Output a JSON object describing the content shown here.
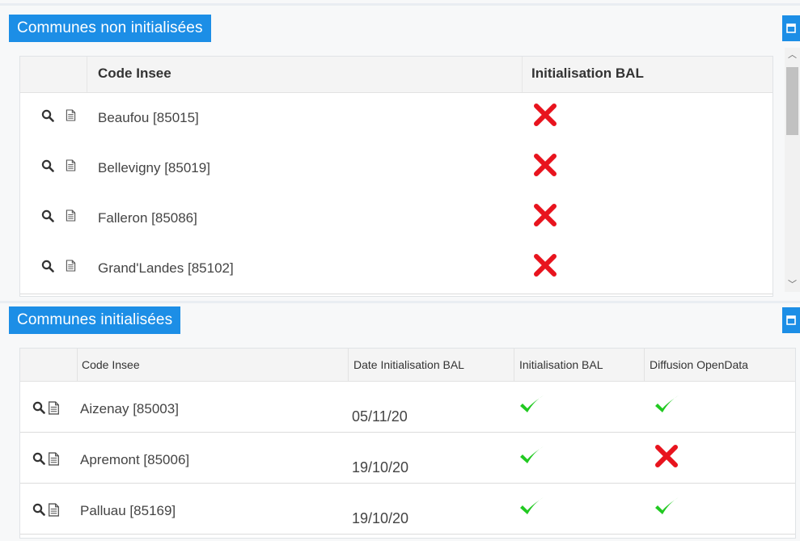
{
  "panels": {
    "top": {
      "title": "Communes non initialisées",
      "columns": {
        "code": "Code Insee",
        "init": "Initialisation BAL"
      },
      "rows": [
        {
          "name": "Beaufou [85015]",
          "init": "cross"
        },
        {
          "name": "Bellevigny [85019]",
          "init": "cross"
        },
        {
          "name": "Falleron [85086]",
          "init": "cross"
        },
        {
          "name": "Grand'Landes [85102]",
          "init": "cross"
        }
      ]
    },
    "bottom": {
      "title": "Communes initialisées",
      "columns": {
        "code": "Code Insee",
        "date": "Date Initialisation BAL",
        "init": "Initialisation BAL",
        "diffusion": "Diffusion OpenData"
      },
      "rows": [
        {
          "name": "Aizenay [85003]",
          "date": "05/11/20",
          "init": "check",
          "diffusion": "check"
        },
        {
          "name": "Apremont [85006]",
          "date": "19/10/20",
          "init": "check",
          "diffusion": "cross"
        },
        {
          "name": "Palluau [85169]",
          "date": "19/10/20",
          "init": "check",
          "diffusion": "check"
        }
      ]
    }
  },
  "icons": {
    "row_actions": [
      "search-icon",
      "document-icon"
    ],
    "status_true": "check-icon",
    "status_false": "cross-icon",
    "collapse": "window-restore-icon"
  },
  "colors": {
    "header_blue": "#1c8ee6",
    "check_green": "#21c921",
    "cross_red": "#e8141e"
  }
}
